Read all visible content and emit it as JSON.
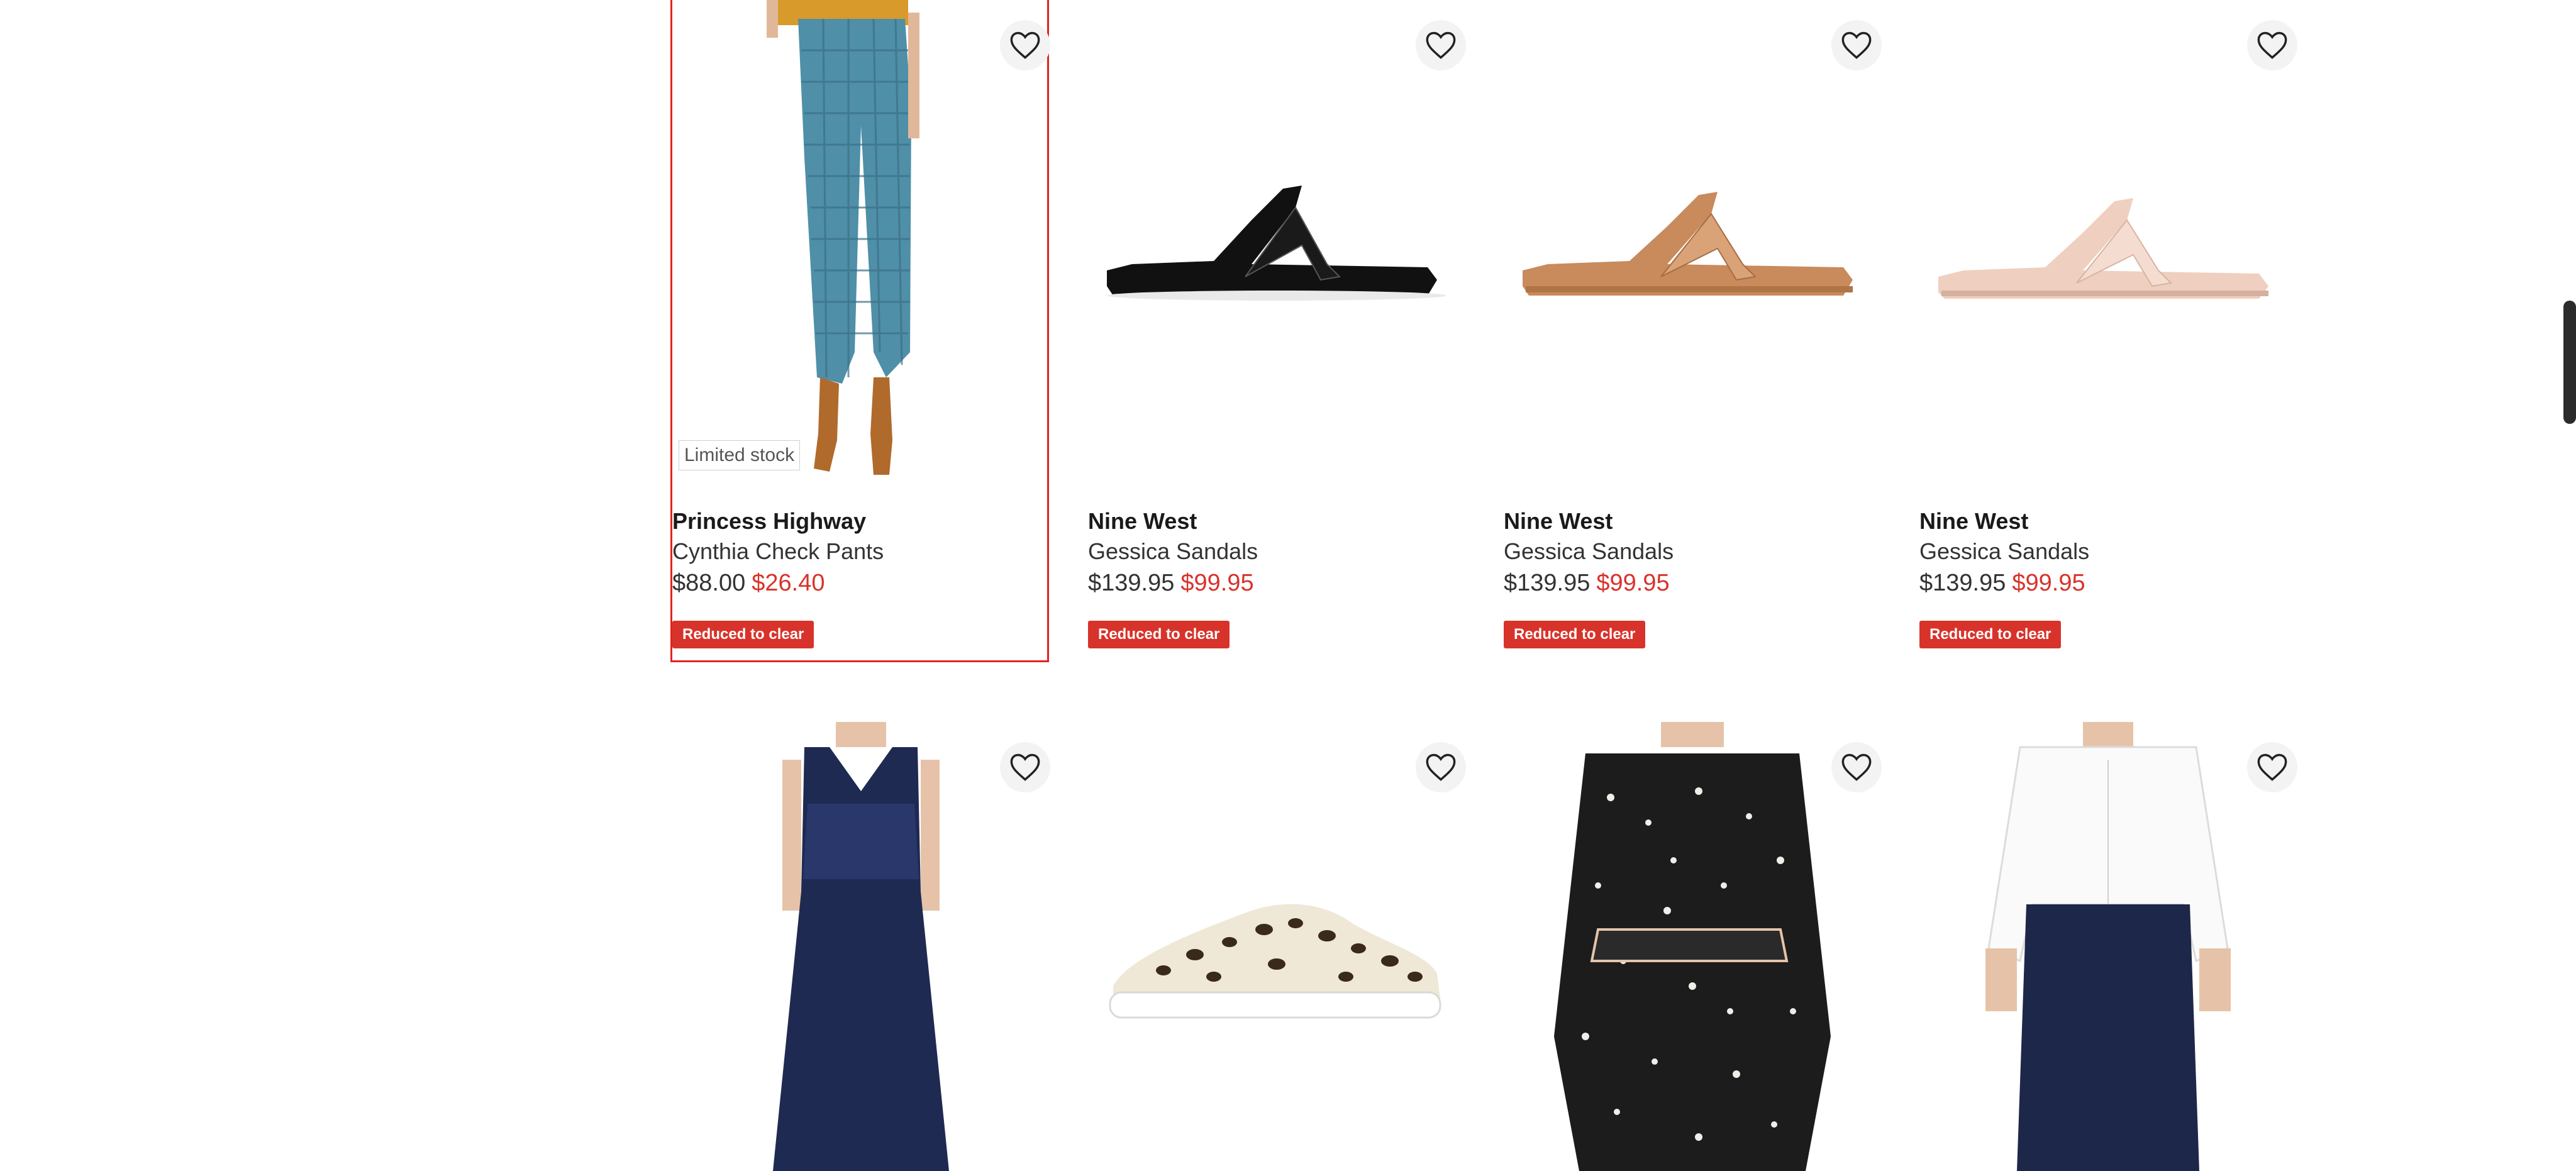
{
  "products": [
    {
      "brand": "Princess Highway",
      "name": "Cynthia Check Pants",
      "was": "$88.00",
      "now": "$26.40",
      "tag": "Reduced to clear",
      "stock_badge": "Limited stock"
    },
    {
      "brand": "Nine West",
      "name": "Gessica Sandals",
      "was": "$139.95",
      "now": "$99.95",
      "tag": "Reduced to clear"
    },
    {
      "brand": "Nine West",
      "name": "Gessica Sandals",
      "was": "$139.95",
      "now": "$99.95",
      "tag": "Reduced to clear"
    },
    {
      "brand": "Nine West",
      "name": "Gessica Sandals",
      "was": "$139.95",
      "now": "$99.95",
      "tag": "Reduced to clear"
    }
  ],
  "colors": {
    "accent_red": "#d8332b",
    "hover_outline": "#e0231f"
  },
  "icons": {
    "wishlist": "heart-icon"
  }
}
